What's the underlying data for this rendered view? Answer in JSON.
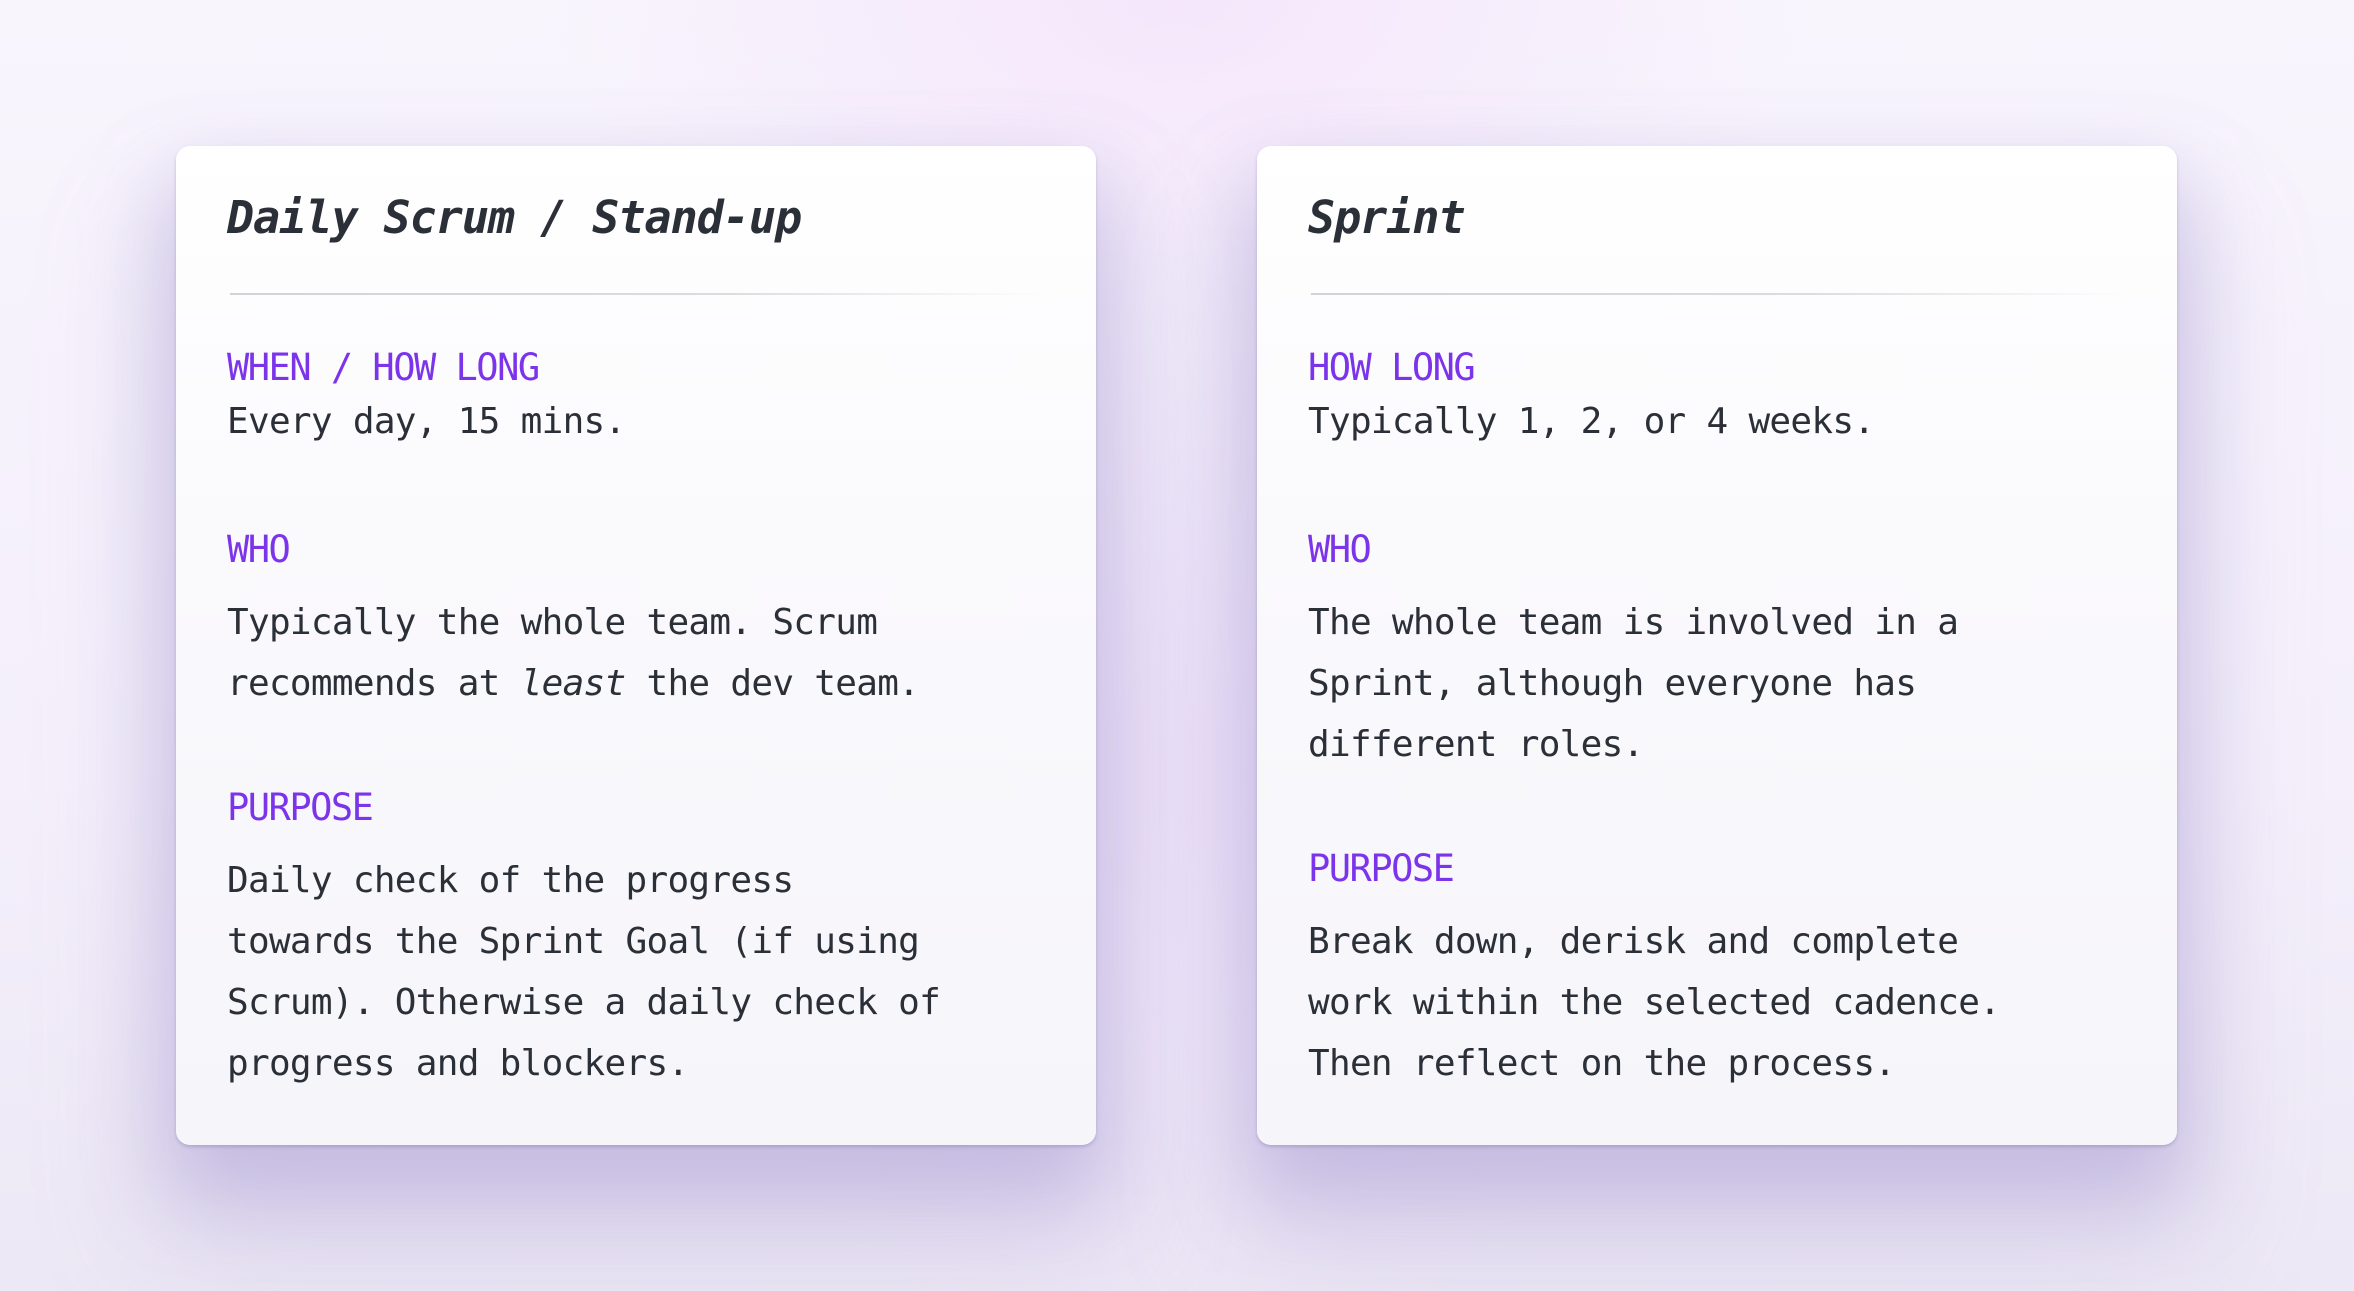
{
  "colors": {
    "accent": "#7c34ea",
    "text": "#2b2f38",
    "card_background": "#f8f7fb",
    "page_background": "#f4effb"
  },
  "cards": [
    {
      "title": "Daily Scrum / Stand-up",
      "sections": [
        {
          "label": "WHEN / HOW LONG",
          "text": "Every day, 15 mins."
        },
        {
          "label": "WHO",
          "text_before_emphasis": "Typically the whole team. Scrum\nrecommends at ",
          "emphasis": "least",
          "text_after_emphasis": " the dev team."
        },
        {
          "label": "PURPOSE",
          "text": "Daily check of the progress\ntowards the Sprint Goal (if using\nScrum). Otherwise a daily check of\nprogress and blockers."
        }
      ]
    },
    {
      "title": "Sprint",
      "sections": [
        {
          "label": "HOW LONG",
          "text": "Typically 1, 2, or 4 weeks."
        },
        {
          "label": "WHO",
          "text": "The whole team is involved in a\nSprint, although everyone has\ndifferent roles."
        },
        {
          "label": "PURPOSE",
          "text": "Break down, derisk and complete\nwork within the selected cadence.\nThen reflect on the process."
        }
      ]
    }
  ]
}
